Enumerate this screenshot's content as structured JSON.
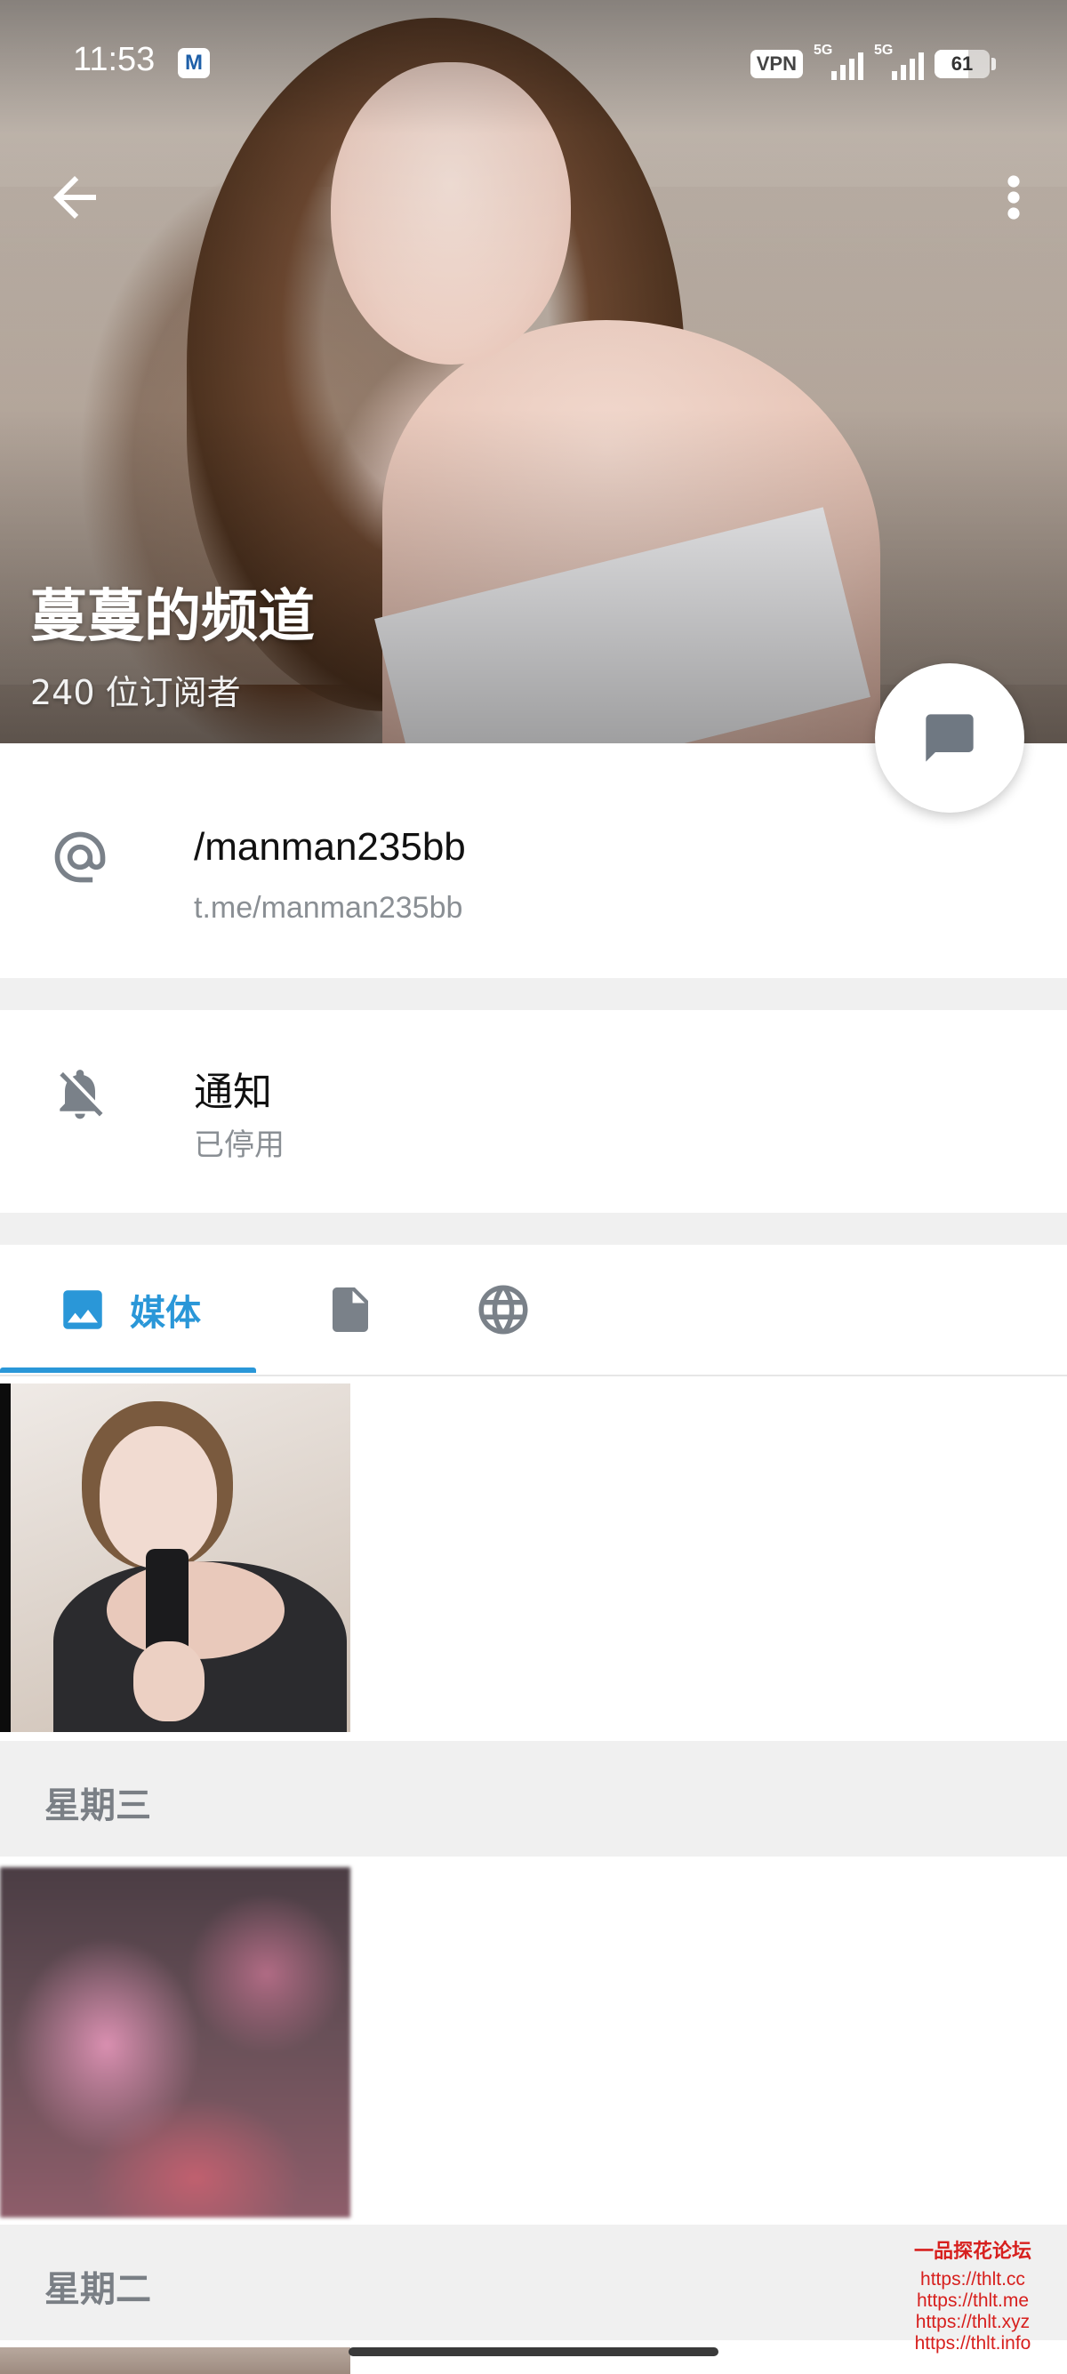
{
  "status_bar": {
    "time": "11:53",
    "app_badge": "M",
    "vpn": "VPN",
    "sim1": "5G",
    "sim2": "5G",
    "battery": "61",
    "battery_level": 0.61
  },
  "header": {
    "title": "蔓蔓的频道",
    "subscribers": "240 位订阅者",
    "back_icon": "arrow-left-icon",
    "menu_icon": "more-vertical-icon",
    "fab_icon": "message-icon"
  },
  "info": {
    "username": "/manman235bb",
    "link": "t.me/manman235bb",
    "username_icon": "at-sign-icon",
    "notifications_label": "通知",
    "notifications_status": "已停用",
    "notifications_icon": "bell-off-icon"
  },
  "tabs": [
    {
      "label": "媒体",
      "icon": "image-icon",
      "active": true
    },
    {
      "label": "",
      "icon": "file-icon",
      "active": false
    },
    {
      "label": "",
      "icon": "globe-icon",
      "active": false
    }
  ],
  "media_sections": [
    {
      "day": "",
      "items": 1
    },
    {
      "day": "星期三",
      "items": 1
    },
    {
      "day": "星期二",
      "items": 1
    }
  ],
  "watermark": {
    "title": "一品探花论坛",
    "urls": [
      "https://thlt.cc",
      "https://thlt.me",
      "https://thlt.xyz",
      "https://thlt.info"
    ]
  },
  "colors": {
    "accent": "#2a97d8",
    "section_bg": "#f0f0f0",
    "secondary_text": "#8a8f94",
    "icon_gray": "#7a8189",
    "watermark": "#d7201e"
  }
}
